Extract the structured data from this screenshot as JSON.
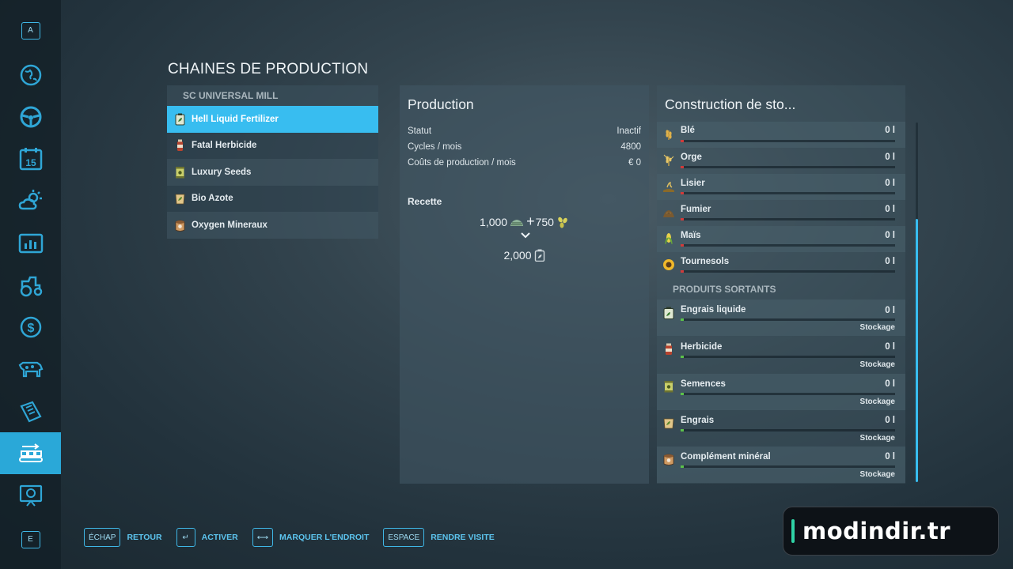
{
  "sidebar": {
    "top_key": "A",
    "bottom_key": "E",
    "calendar_day": "15",
    "items": [
      {
        "icon": "globe-map-icon"
      },
      {
        "icon": "steering-wheel-icon"
      },
      {
        "icon": "calendar-icon"
      },
      {
        "icon": "weather-icon"
      },
      {
        "icon": "statistics-icon"
      },
      {
        "icon": "tractor-icon"
      },
      {
        "icon": "finances-icon"
      },
      {
        "icon": "animals-icon"
      },
      {
        "icon": "contracts-icon"
      },
      {
        "icon": "production-chains-icon",
        "active": true
      },
      {
        "icon": "help-icon"
      }
    ]
  },
  "page": {
    "title": "CHAINES DE PRODUCTION"
  },
  "chains": {
    "group": "SC UNIVERSAL MILL",
    "items": [
      {
        "label": "Hell Liquid Fertilizer",
        "icon": "liquid-fertilizer-icon",
        "selected": true
      },
      {
        "label": "Fatal Herbicide",
        "icon": "herbicide-icon"
      },
      {
        "label": "Luxury Seeds",
        "icon": "seeds-icon"
      },
      {
        "label": "Bio Azote",
        "icon": "fertilizer-icon"
      },
      {
        "label": "Oxygen Mineraux",
        "icon": "mineral-icon"
      }
    ]
  },
  "production": {
    "title": "Production",
    "stats": [
      {
        "label": "Statut",
        "value": "Inactif"
      },
      {
        "label": "Cycles / mois",
        "value": "4800"
      },
      {
        "label": "Coûts de production / mois",
        "value": "€ 0"
      }
    ],
    "recipe_title": "Recette",
    "input_a": "1,000",
    "input_b": "750",
    "plus": "+",
    "output": "2,000"
  },
  "storage": {
    "title": "Construction de sto...",
    "inputs": [
      {
        "name": "Blé",
        "qty": "0 l",
        "icon": "wheat-icon",
        "level": 0
      },
      {
        "name": "Orge",
        "qty": "0 l",
        "icon": "barley-icon",
        "level": 0
      },
      {
        "name": "Lisier",
        "qty": "0 l",
        "icon": "slurry-icon",
        "level": 0
      },
      {
        "name": "Fumier",
        "qty": "0 l",
        "icon": "manure-icon",
        "level": 0
      },
      {
        "name": "Maïs",
        "qty": "0 l",
        "icon": "maize-icon",
        "level": 0
      },
      {
        "name": "Tournesols",
        "qty": "0 l",
        "icon": "sunflower-icon",
        "level": 0
      }
    ],
    "outputs_header": "PRODUITS SORTANTS",
    "outputs": [
      {
        "name": "Engrais liquide",
        "qty": "0 l",
        "mode": "Stockage",
        "icon": "liquid-fertilizer-icon",
        "level": 0
      },
      {
        "name": "Herbicide",
        "qty": "0 l",
        "mode": "Stockage",
        "icon": "herbicide-icon",
        "level": 0
      },
      {
        "name": "Semences",
        "qty": "0 l",
        "mode": "Stockage",
        "icon": "seeds-icon",
        "level": 0
      },
      {
        "name": "Engrais",
        "qty": "0 l",
        "mode": "Stockage",
        "icon": "fertilizer-icon",
        "level": 0
      },
      {
        "name": "Complément minéral",
        "qty": "0 l",
        "mode": "Stockage",
        "icon": "mineral-icon",
        "level": 0
      }
    ],
    "colors": {
      "input_fill": "#d23a3a",
      "output_fill": "#5bc24a"
    }
  },
  "footer": {
    "hints": [
      {
        "key": "ÉCHAP",
        "label": "RETOUR"
      },
      {
        "key": "↵",
        "label": "ACTIVER"
      },
      {
        "key": "⟷",
        "label": "MARQUER L'ENDROIT"
      },
      {
        "key": "ESPACE",
        "label": "RENDRE VISITE"
      }
    ]
  },
  "watermark": {
    "text": "modindir.tr"
  },
  "colors": {
    "accent": "#38bdf0",
    "key_border": "#3fb7e6"
  }
}
